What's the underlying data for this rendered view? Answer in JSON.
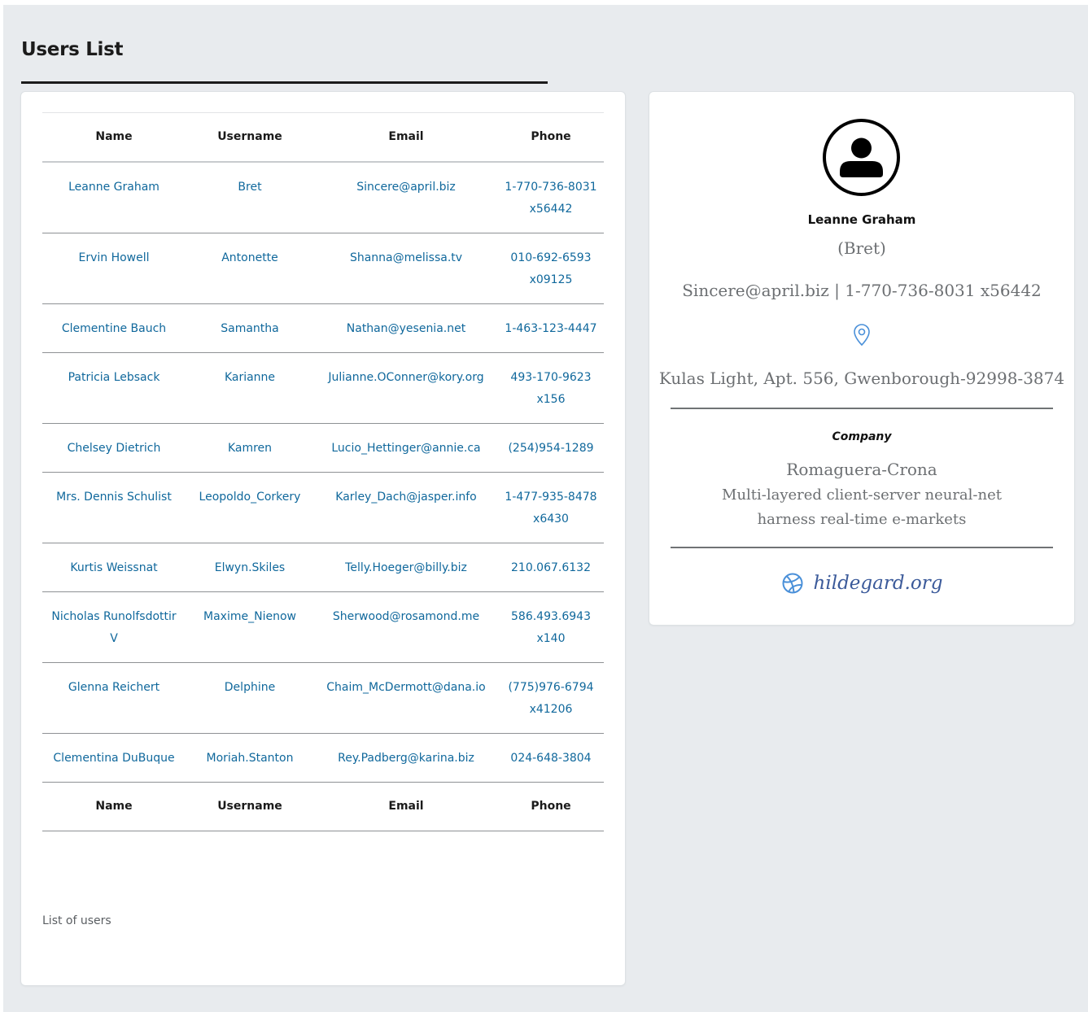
{
  "page": {
    "title": "Users List"
  },
  "table": {
    "columns": [
      "Name",
      "Username",
      "Email",
      "Phone"
    ],
    "rows": [
      {
        "name": "Leanne Graham",
        "username": "Bret",
        "email": "Sincere@april.biz",
        "phone": "1-770-736-8031 x56442"
      },
      {
        "name": "Ervin Howell",
        "username": "Antonette",
        "email": "Shanna@melissa.tv",
        "phone": "010-692-6593 x09125"
      },
      {
        "name": "Clementine Bauch",
        "username": "Samantha",
        "email": "Nathan@yesenia.net",
        "phone": "1-463-123-4447"
      },
      {
        "name": "Patricia Lebsack",
        "username": "Karianne",
        "email": "Julianne.OConner@kory.org",
        "phone": "493-170-9623 x156"
      },
      {
        "name": "Chelsey Dietrich",
        "username": "Kamren",
        "email": "Lucio_Hettinger@annie.ca",
        "phone": "(254)954-1289"
      },
      {
        "name": "Mrs. Dennis Schulist",
        "username": "Leopoldo_Corkery",
        "email": "Karley_Dach@jasper.info",
        "phone": "1-477-935-8478 x6430"
      },
      {
        "name": "Kurtis Weissnat",
        "username": "Elwyn.Skiles",
        "email": "Telly.Hoeger@billy.biz",
        "phone": "210.067.6132"
      },
      {
        "name": "Nicholas Runolfsdottir V",
        "username": "Maxime_Nienow",
        "email": "Sherwood@rosamond.me",
        "phone": "586.493.6943 x140"
      },
      {
        "name": "Glenna Reichert",
        "username": "Delphine",
        "email": "Chaim_McDermott@dana.io",
        "phone": "(775)976-6794 x41206"
      },
      {
        "name": "Clementina DuBuque",
        "username": "Moriah.Stanton",
        "email": "Rey.Padberg@karina.biz",
        "phone": "024-648-3804"
      }
    ],
    "caption": "List of users"
  },
  "detail": {
    "name": "Leanne Graham",
    "username": "(Bret)",
    "contact": "Sincere@april.biz | 1-770-736-8031 x56442",
    "address": "Kulas Light, Apt. 556, Gwenborough-92998-3874",
    "company_label": "Company",
    "company_name": "Romaguera-Crona",
    "company_catchphrase": "Multi-layered client-server neural-net",
    "company_bs": "harness real-time e-markets",
    "website": "hildegard.org",
    "icons": {
      "avatar": "user-circle-icon",
      "location": "map-pin-icon",
      "website": "dribbble-globe-icon"
    },
    "colors": {
      "accent": "#10689c",
      "pin": "#4a90d9",
      "website": "#3b5a9a"
    }
  }
}
